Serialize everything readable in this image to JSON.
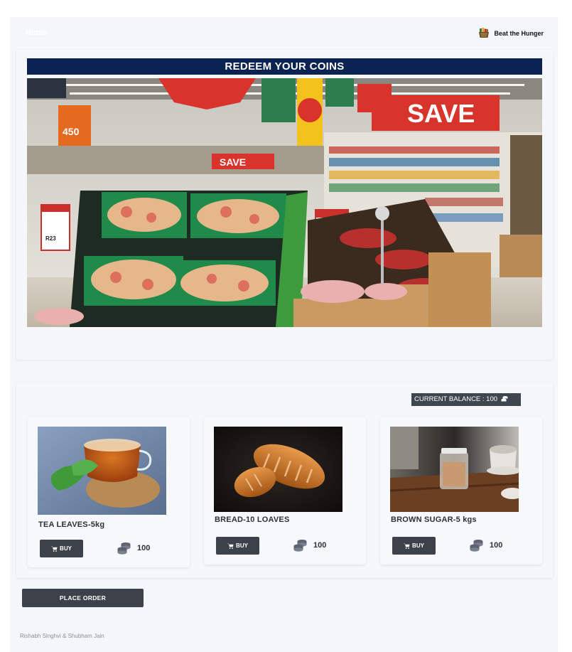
{
  "navbar": {
    "brand_left": "Home",
    "brand_right": "Beat the Hunger",
    "logo_icon": "grocery-basket-icon"
  },
  "hero": {
    "title": "REDEEM YOUR COINS",
    "image_icon": "supermarket-produce-photo"
  },
  "shop": {
    "balance_label": "CURRENT BALANCE : 100",
    "balance_icon": "coin-stack-icon",
    "buy_label": "BUY",
    "buy_icon": "cart-icon",
    "price_icon": "coin-stack-icon",
    "products": [
      {
        "name": "TEA LEAVES-5kg",
        "price": "100",
        "image_icon": "tea-cup-photo"
      },
      {
        "name": "BREAD-10 LOAVES",
        "price": "100",
        "image_icon": "bread-loaves-photo"
      },
      {
        "name": "BROWN SUGAR-5 kgs",
        "price": "100",
        "image_icon": "sugar-jar-photo"
      }
    ]
  },
  "place_order_label": "PLACE ORDER",
  "footer": {
    "credits": "Rishabh Singhvi & Shubham Jain"
  },
  "colors": {
    "title_bar": "#0a2352",
    "button": "#3d4149",
    "background": "#f3f6fb"
  }
}
